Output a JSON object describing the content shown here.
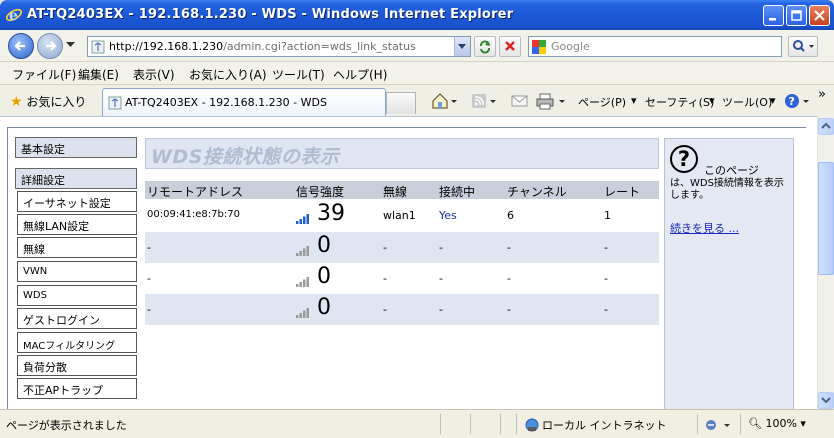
{
  "window": {
    "title": "AT-TQ2403EX - 192.168.1.230 - WDS - Windows Internet Explorer"
  },
  "address": {
    "url_host": "http://192.168.1.230",
    "url_path": "/admin.cgi?action=wds_link_status",
    "search_placeholder": "Google"
  },
  "menu": [
    "ファイル(F)",
    "編集(E)",
    "表示(V)",
    "お気に入り(A)",
    "ツール(T)",
    "ヘルプ(H)"
  ],
  "tabs": {
    "favorites_label": "お気に入り",
    "active_tab": "AT-TQ2403EX - 192.168.1.230 - WDS",
    "page_label": "ページ(P)",
    "safety_label": "セーフティ(S)",
    "tools_label": "ツール(O)",
    "chevron": "»"
  },
  "sidebar": {
    "items": [
      "基本設定",
      "詳細設定",
      "イーサネット設定",
      "無線LAN設定",
      "無線",
      "VWN",
      "WDS",
      "ゲストログイン",
      "MACフィルタリング",
      "負荷分散",
      "不正APトラップ"
    ]
  },
  "main": {
    "title": "WDS接続状態の表示",
    "columns": [
      "リモートアドレス",
      "信号強度",
      "無線",
      "接続中",
      "チャンネル",
      "レート"
    ],
    "rows": [
      {
        "address": "00:09:41:e8:7b:70",
        "signal": "39",
        "radio": "wlan1",
        "connected": "Yes",
        "channel": "6",
        "rate": "1"
      },
      {
        "address": "-",
        "signal": "0",
        "radio": "-",
        "connected": "-",
        "channel": "-",
        "rate": "-"
      },
      {
        "address": "-",
        "signal": "0",
        "radio": "-",
        "connected": "-",
        "channel": "-",
        "rate": "-"
      },
      {
        "address": "-",
        "signal": "0",
        "radio": "-",
        "connected": "-",
        "channel": "-",
        "rate": "-"
      }
    ]
  },
  "help": {
    "heading": "このページ",
    "text": "は、WDS接続情報を表示します。",
    "more_link": "続きを見る ..."
  },
  "status": {
    "text": "ページが表示されました",
    "zone": "ローカル イントラネット",
    "zoom": "100%"
  },
  "colors": {
    "titlebar": "#1c58d6",
    "signal_active": "#1f5fcc",
    "signal_inactive": "#9a9a9a",
    "link": "#1a2bbf"
  }
}
